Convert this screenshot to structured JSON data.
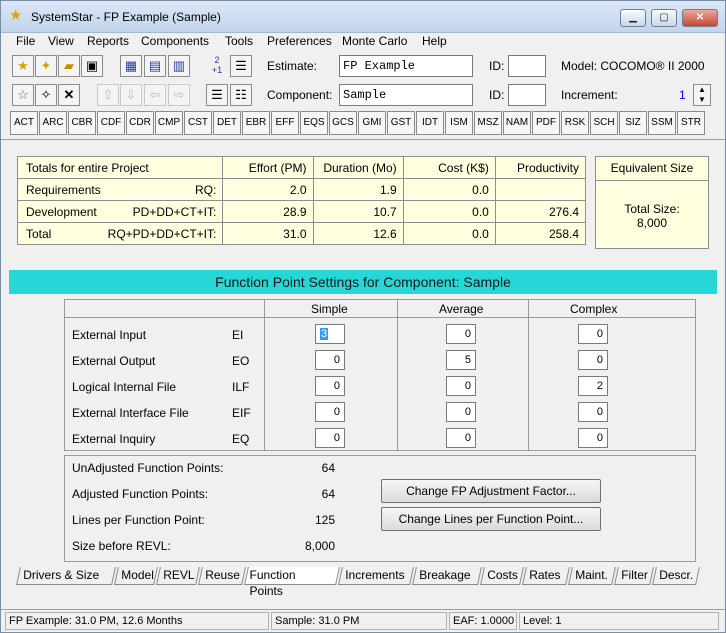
{
  "window": {
    "title": "SystemStar - FP Example (Sample)"
  },
  "menu": [
    {
      "label": "File"
    },
    {
      "label": "View"
    },
    {
      "label": "Reports"
    },
    {
      "label": "Components"
    },
    {
      "label": "Tools"
    },
    {
      "label": "Preferences"
    },
    {
      "label": "Monte Carlo"
    },
    {
      "label": "Help"
    }
  ],
  "toolbar": {
    "increment_icon_text": "2\n+1",
    "estimate_label": "Estimate:",
    "estimate_value": "FP Example",
    "component_label": "Component:",
    "component_value": "Sample",
    "id_label": "ID:",
    "model_label": "Model: COCOMO® II 2000",
    "increment_label": "Increment:",
    "increment_value": "1"
  },
  "drivers": [
    "ACT",
    "ARC",
    "CBR",
    "CDF",
    "CDR",
    "CMP",
    "CST",
    "DET",
    "EBR",
    "EFF",
    "EQS",
    "GCS",
    "GMI",
    "GST",
    "IDT",
    "ISM",
    "MSZ",
    "NAM",
    "PDF",
    "RSK",
    "SCH",
    "SIZ",
    "SSM",
    "STR"
  ],
  "totals": {
    "header": [
      "Totals for entire Project",
      "Effort (PM)",
      "Duration (Mo)",
      "Cost (K$)",
      "Productivity"
    ],
    "rows": [
      {
        "name": "Requirements",
        "code": "RQ:",
        "effort": "2.0",
        "duration": "1.9",
        "cost": "0.0",
        "productivity": ""
      },
      {
        "name": "Development",
        "code": "PD+DD+CT+IT:",
        "effort": "28.9",
        "duration": "10.7",
        "cost": "0.0",
        "productivity": "276.4"
      },
      {
        "name": "Total",
        "code": "RQ+PD+DD+CT+IT:",
        "effort": "31.0",
        "duration": "12.6",
        "cost": "0.0",
        "productivity": "258.4"
      }
    ]
  },
  "equivalent_size": {
    "title": "Equivalent Size",
    "line1": "Total Size:",
    "line2": "8,000"
  },
  "fp": {
    "banner": "Function Point Settings for Component: Sample",
    "columns": [
      "Simple",
      "Average",
      "Complex"
    ],
    "rows": [
      {
        "name": "External Input",
        "code": "EI",
        "simple": "3",
        "average": "0",
        "complex": "0"
      },
      {
        "name": "External Output",
        "code": "EO",
        "simple": "0",
        "average": "5",
        "complex": "0"
      },
      {
        "name": "Logical Internal File",
        "code": "ILF",
        "simple": "0",
        "average": "0",
        "complex": "2"
      },
      {
        "name": "External Interface File",
        "code": "EIF",
        "simple": "0",
        "average": "0",
        "complex": "0"
      },
      {
        "name": "External Inquiry",
        "code": "EQ",
        "simple": "0",
        "average": "0",
        "complex": "0"
      }
    ],
    "summary": [
      {
        "label": "UnAdjusted Function Points:",
        "value": "64"
      },
      {
        "label": "Adjusted Function Points:",
        "value": "64"
      },
      {
        "label": "Lines per Function Point:",
        "value": "125"
      },
      {
        "label": "Size before REVL:",
        "value": "8,000"
      }
    ],
    "btn_adjust": "Change FP Adjustment Factor...",
    "btn_lines": "Change Lines per Function Point..."
  },
  "tabs": [
    "Drivers & Size",
    "Model",
    "REVL",
    "Reuse",
    "Function Points",
    "Increments",
    "Breakage",
    "Costs",
    "Rates",
    "Maint.",
    "Filter",
    "Descr."
  ],
  "active_tab": "Function Points",
  "status": {
    "left": "FP Example:  31.0 PM,  12.6 Months",
    "mid": "Sample:  31.0 PM",
    "eaf": "EAF: 1.0000",
    "level": "Level:  1"
  },
  "colors": {
    "banner": "#27d6d6",
    "yellow_panel": "#ffffe0",
    "selection": "#3399ff",
    "increment_link": "#0000ff"
  }
}
